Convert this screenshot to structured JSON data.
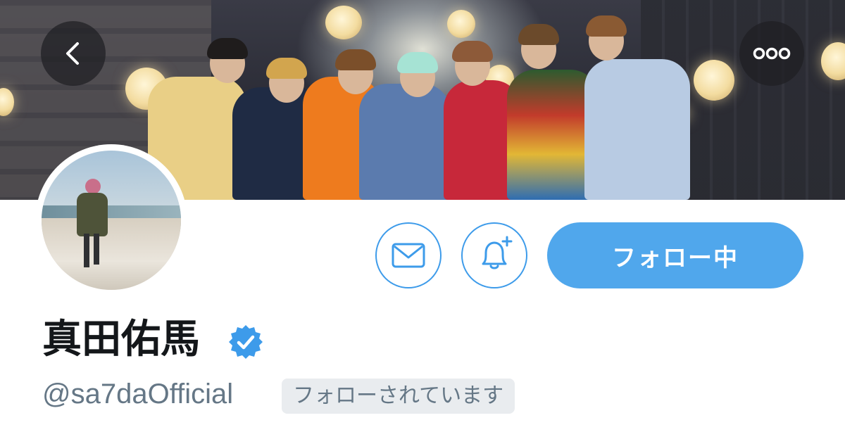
{
  "profile": {
    "display_name": "真田佑馬",
    "handle": "@sa7daOfficial",
    "follows_you_label": "フォローされています",
    "verified": true
  },
  "actions": {
    "follow_label": "フォロー中",
    "message_icon": "envelope-icon",
    "notify_icon": "bell-plus-icon"
  },
  "navigation": {
    "back_icon": "chevron-left-icon",
    "more_icon": "more-dots-icon"
  },
  "colors": {
    "accent": "#50a7ec",
    "accent_border": "#3d9bea",
    "text_primary": "#14171a",
    "text_secondary": "#657786",
    "badge_bg": "#e9ecef"
  }
}
